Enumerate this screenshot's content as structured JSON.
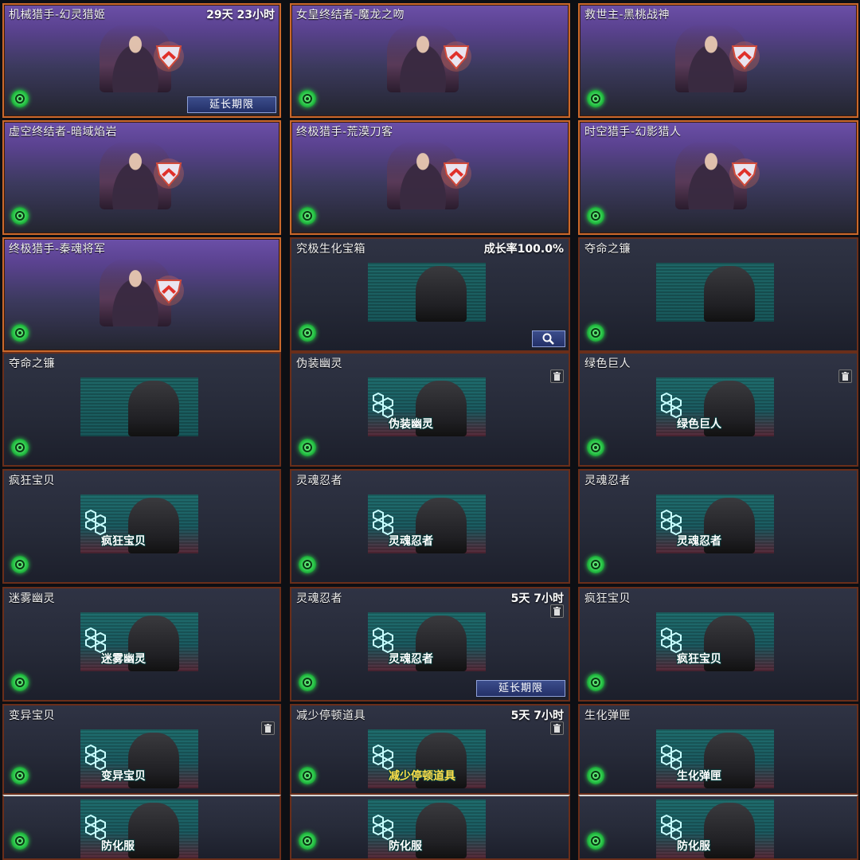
{
  "cards": [
    {
      "name": "机械猎手-幻灵猎姬",
      "right": "29天 23小时",
      "button": "延长期限",
      "type": "hero"
    },
    {
      "name": "女皇终结者-魔龙之吻",
      "type": "hero"
    },
    {
      "name": "救世主-黑桃战神",
      "type": "hero"
    },
    {
      "name": "虚空终结者-暗域焰岩",
      "type": "hero"
    },
    {
      "name": "终极猎手-荒漠刀客",
      "type": "hero"
    },
    {
      "name": "时空猎手-幻影猎人",
      "type": "hero"
    },
    {
      "name": "终极猎手-秦魂将军",
      "type": "hero"
    },
    {
      "name": "究极生化宝箱",
      "right": "成长率100.0%",
      "type": "item",
      "search": true
    },
    {
      "name": "夺命之镰",
      "type": "item"
    },
    {
      "name": "夺命之镰",
      "type": "item"
    },
    {
      "name": "伪装幽灵",
      "panel_label": "伪装幽灵",
      "type": "item",
      "trash": true
    },
    {
      "name": "绿色巨人",
      "panel_label": "绿色巨人",
      "type": "item",
      "trash": true
    },
    {
      "name": "疯狂宝贝",
      "panel_label": "疯狂宝贝",
      "type": "item"
    },
    {
      "name": "灵魂忍者",
      "panel_label": "灵魂忍者",
      "type": "item"
    },
    {
      "name": "灵魂忍者",
      "panel_label": "灵魂忍者",
      "type": "item"
    },
    {
      "name": "迷雾幽灵",
      "panel_label": "迷雾幽灵",
      "type": "item"
    },
    {
      "name": "灵魂忍者",
      "panel_label": "灵魂忍者",
      "right": "5天 7小时",
      "button": "延长期限",
      "type": "item",
      "trash": true
    },
    {
      "name": "疯狂宝贝",
      "panel_label": "疯狂宝贝",
      "type": "item"
    },
    {
      "name": "变异宝贝",
      "panel_label": "变异宝贝",
      "type": "item",
      "trash": true
    },
    {
      "name": "减少停顿道具",
      "panel_label": "减少停顿道具",
      "right": "5天 7小时",
      "type": "item",
      "trash": true
    },
    {
      "name": "生化弹匣",
      "panel_label": "生化弹匣",
      "type": "item"
    },
    {
      "panel_label": "防化服",
      "type": "item"
    },
    {
      "panel_label": "防化服",
      "type": "item"
    },
    {
      "panel_label": "防化服",
      "type": "item"
    }
  ],
  "colors": {
    "hero_border": "#c9682c",
    "item_border": "#6a2e1a",
    "eco_green": "#26c245",
    "button_blue": "#233067"
  },
  "icons": {
    "eco": "eco-badge-icon",
    "search": "magnifier-icon",
    "trash": "trash-icon"
  }
}
